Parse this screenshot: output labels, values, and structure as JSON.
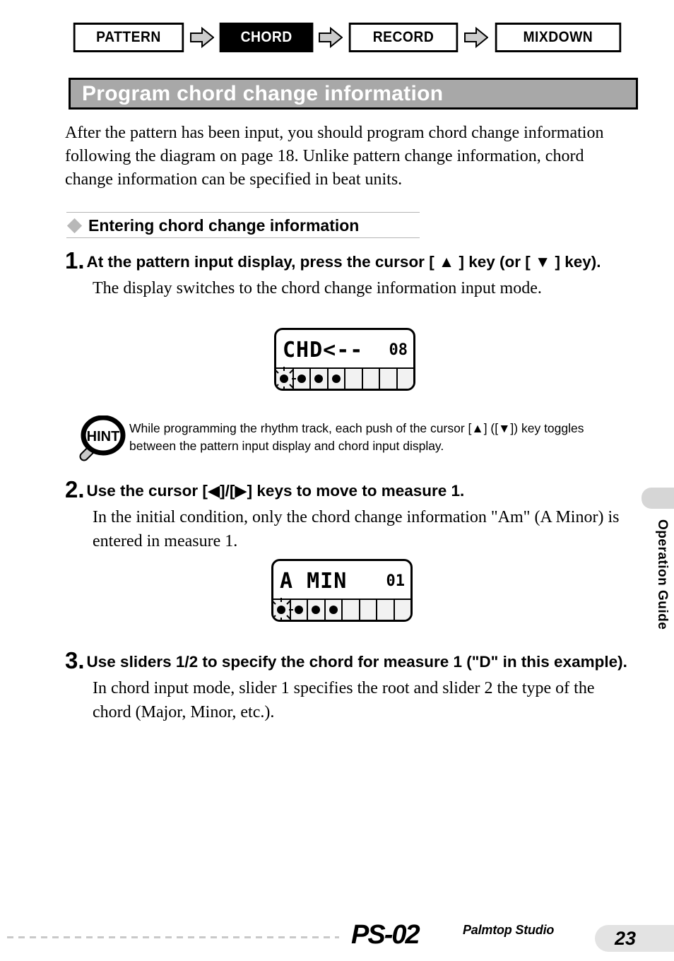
{
  "nav": {
    "items": [
      {
        "label": "PATTERN",
        "active": false
      },
      {
        "label": "CHORD",
        "active": true
      },
      {
        "label": "RECORD",
        "active": false
      },
      {
        "label": "MIXDOWN",
        "active": false
      }
    ]
  },
  "title": "Program chord change information",
  "intro": "After the pattern has been input, you should program chord change information following the diagram on page 18. Unlike pattern change information, chord change information can be specified in beat units.",
  "subsection": {
    "bullet": "diamond-bullet-icon",
    "title": "Entering chord change information"
  },
  "steps": [
    {
      "number": "1.",
      "title": "At the pattern input display, press the cursor [ ▲ ] key (or [ ▼ ] key).",
      "body": "The display switches to the chord change information input mode."
    },
    {
      "number": "2.",
      "title": "Use the cursor [◀]/[▶] keys to move to measure 1.",
      "body": "In the initial condition, only the chord change information \"Am\" (A Minor) is entered in measure 1."
    },
    {
      "number": "3.",
      "title": "Use sliders 1/2 to specify the chord for measure 1 (\"D\" in this example).",
      "body": "In chord input mode, slider 1 specifies the root and slider 2 the type of the chord (Major, Minor, etc.)."
    }
  ],
  "lcd1": {
    "main_text": "CHD<--",
    "value": "08",
    "beats": [
      {
        "dot": true,
        "blinking": true
      },
      {
        "dot": true,
        "blinking": false
      },
      {
        "dot": true,
        "blinking": false
      },
      {
        "dot": true,
        "blinking": false
      },
      {
        "dot": false,
        "blinking": false
      },
      {
        "dot": false,
        "blinking": false
      },
      {
        "dot": false,
        "blinking": false
      },
      {
        "dot": false,
        "blinking": false
      }
    ]
  },
  "lcd2": {
    "main_text": "A MIN",
    "value": "01",
    "beats": [
      {
        "dot": true,
        "blinking": true
      },
      {
        "dot": true,
        "blinking": false
      },
      {
        "dot": true,
        "blinking": false
      },
      {
        "dot": true,
        "blinking": false
      },
      {
        "dot": false,
        "blinking": false
      },
      {
        "dot": false,
        "blinking": false
      },
      {
        "dot": false,
        "blinking": false
      },
      {
        "dot": false,
        "blinking": false
      }
    ]
  },
  "hint": {
    "icon_label": "HINT",
    "text": "While programming the rhythm track, each push of the cursor [▲] ([▼]) key toggles between the pattern input display and chord input display."
  },
  "side_tab": {
    "label": "Operation Guide"
  },
  "footer": {
    "product": "PS-02",
    "subtitle": "Palmtop Studio",
    "page_number": "23"
  },
  "colors": {
    "banner_gray": "#a8a8a8",
    "accent_black": "#000000",
    "tab_gray": "#d6d6d6",
    "badge_gray": "#e3e3e3",
    "arrow_gray": "#cccccc"
  }
}
